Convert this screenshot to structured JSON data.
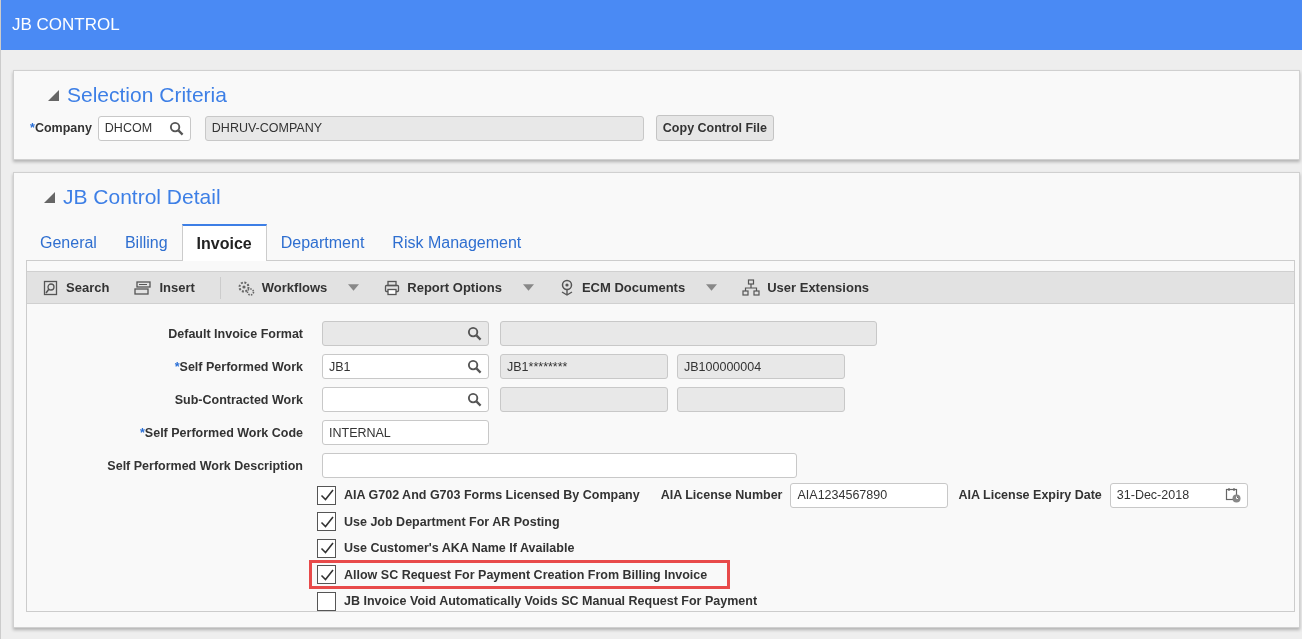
{
  "header": {
    "title": "JB CONTROL"
  },
  "selection_criteria": {
    "title": "Selection Criteria",
    "expanded": true,
    "company": {
      "required_mark": "*",
      "label": "Company",
      "value": "DHCOM"
    },
    "company_name": "DHRUV-COMPANY",
    "button": "Copy Control File"
  },
  "detail": {
    "title": "JB Control Detail",
    "expanded": true,
    "tabs": [
      {
        "label": "General",
        "selected": false
      },
      {
        "label": "Billing",
        "selected": false
      },
      {
        "label": "Invoice",
        "selected": true
      },
      {
        "label": "Department",
        "selected": false
      },
      {
        "label": "Risk Management",
        "selected": false
      }
    ],
    "toolbar": [
      {
        "label": "Search",
        "kind": "search",
        "dropdown": false
      },
      {
        "label": "Insert",
        "kind": "insert",
        "dropdown": false
      },
      {
        "label": "Workflows",
        "kind": "workflow",
        "dropdown": true
      },
      {
        "label": "Report Options",
        "kind": "report",
        "dropdown": true
      },
      {
        "label": "ECM Documents",
        "kind": "documents",
        "dropdown": true
      },
      {
        "label": "User Extensions",
        "kind": "extensions",
        "dropdown": false
      }
    ],
    "rows": [
      {
        "label": "Default Invoice Format",
        "fields": [
          {
            "kind": "lookup",
            "disabled": true
          },
          {
            "kind": "display-long"
          }
        ]
      },
      {
        "required_mark": "*",
        "label": "Self Performed Work",
        "fields": [
          {
            "kind": "lookup",
            "disabled": false,
            "value": "JB1"
          },
          {
            "kind": "display",
            "value": "JB1********"
          },
          {
            "kind": "display",
            "value": "JB100000004"
          }
        ]
      },
      {
        "label": "Sub-Contracted Work",
        "fields": [
          {
            "kind": "lookup",
            "disabled": false
          },
          {
            "kind": "display"
          },
          {
            "kind": "display"
          }
        ]
      },
      {
        "required_mark": "*",
        "label": "Self Performed Work Code",
        "fields": [
          {
            "kind": "text",
            "value": "INTERNAL"
          }
        ]
      },
      {
        "label": "Self Performed Work Description",
        "fields": [
          {
            "kind": "text-long"
          }
        ]
      }
    ],
    "checkboxes": [
      {
        "label": "AIA G702 And G703 Forms Licensed By Company",
        "checked": true,
        "highlighted": false,
        "extras": [
          {
            "label": "AIA License Number",
            "kind": "text",
            "value": "AIA1234567890"
          },
          {
            "label": "AIA License Expiry Date",
            "kind": "date",
            "value": "31-Dec-2018"
          }
        ]
      },
      {
        "label": "Use Job Department For AR Posting",
        "checked": true,
        "highlighted": false
      },
      {
        "label": "Use Customer's AKA Name If Available",
        "checked": true,
        "highlighted": false
      },
      {
        "label": "Allow SC Request For Payment Creation From Billing Invoice",
        "checked": true,
        "highlighted": true
      },
      {
        "label": "JB Invoice Void Automatically Voids SC Manual Request For Payment",
        "checked": false,
        "highlighted": false
      }
    ]
  }
}
